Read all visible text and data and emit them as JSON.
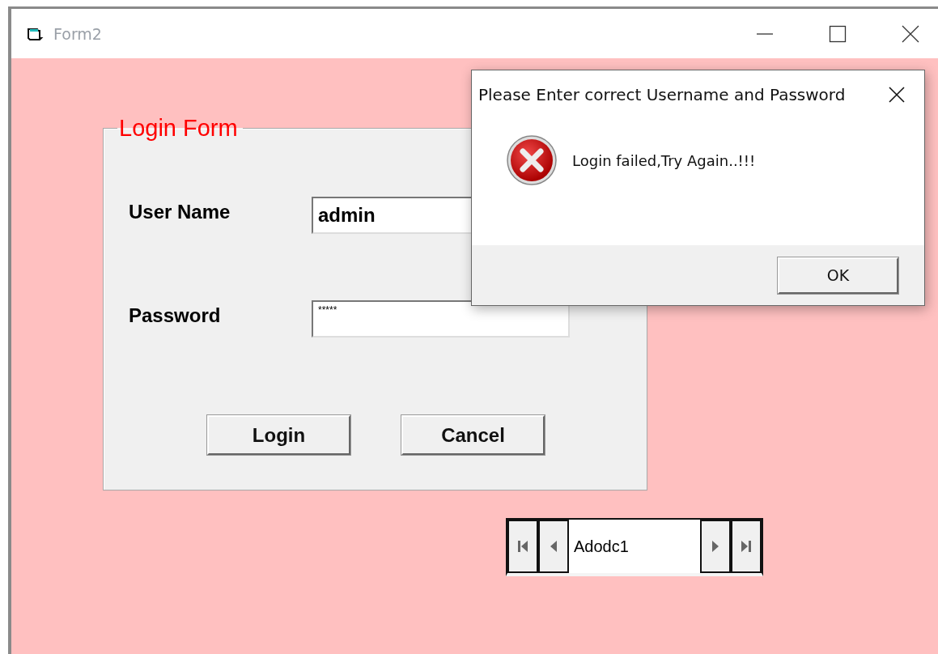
{
  "window": {
    "title": "Form2"
  },
  "login_form": {
    "title": "Login Form",
    "fields": [
      {
        "label": "User Name",
        "value": "admin",
        "kind": "text"
      },
      {
        "label": "Password",
        "value": "*****",
        "kind": "masked"
      }
    ],
    "buttons": [
      "Login",
      "Cancel"
    ]
  },
  "data_control": {
    "caption": "Adodc1"
  },
  "dialog": {
    "title": "Please Enter correct Username and Password",
    "message": "Login failed,Try Again..!!!",
    "button": "OK"
  }
}
